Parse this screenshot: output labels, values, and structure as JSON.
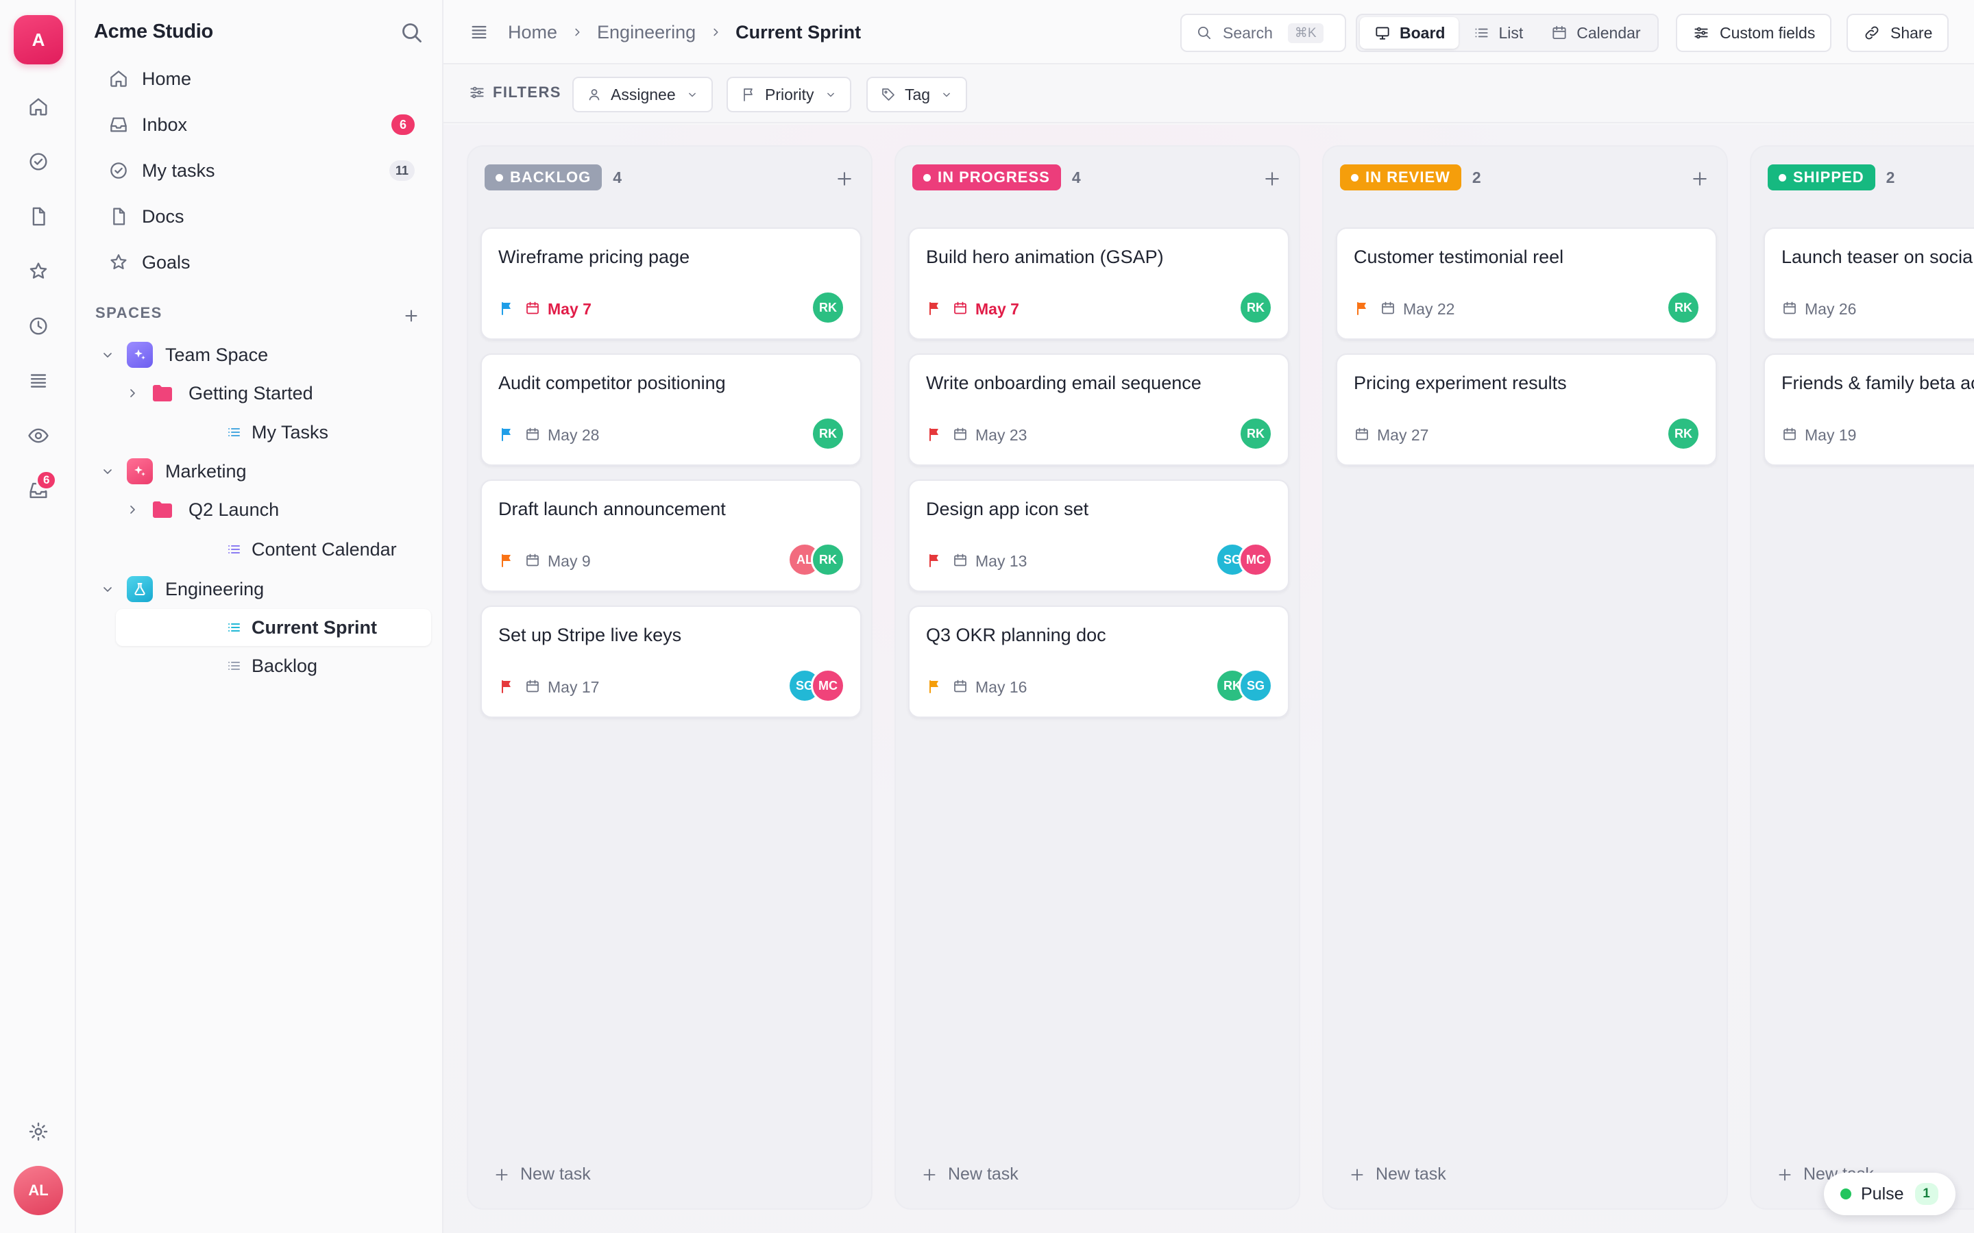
{
  "workspace": {
    "initial": "A",
    "name": "Acme Studio",
    "user_initials": "AL",
    "rail_inbox_badge": "6"
  },
  "nav": [
    {
      "label": "Home",
      "icon": "home-icon"
    },
    {
      "label": "Inbox",
      "icon": "inbox-icon",
      "count": "6"
    },
    {
      "label": "My tasks",
      "icon": "check-circle-icon",
      "count": "11"
    },
    {
      "label": "Docs",
      "icon": "doc-icon"
    },
    {
      "label": "Goals",
      "icon": "star-icon"
    }
  ],
  "spaces": {
    "heading": "SPACES",
    "items": [
      {
        "label": "Team Space",
        "color": "#7c6cf0",
        "children": [
          {
            "label": "Getting Started",
            "type": "folder"
          },
          {
            "label": "My Tasks",
            "type": "list"
          }
        ]
      },
      {
        "label": "Marketing",
        "color": "#f0437a",
        "children": [
          {
            "label": "Q2 Launch",
            "type": "folder"
          },
          {
            "label": "Content Calendar",
            "type": "list"
          }
        ]
      },
      {
        "label": "Engineering",
        "color": "#22b8d6",
        "children": [
          {
            "label": "Current Sprint",
            "type": "list",
            "active": true
          },
          {
            "label": "Backlog",
            "type": "list"
          }
        ]
      }
    ]
  },
  "breadcrumb": {
    "home": "Home",
    "space": "Engineering",
    "current": "Current Sprint"
  },
  "toolbar": {
    "search_label": "Search",
    "search_shortcut": "⌘K",
    "views": [
      {
        "label": "Board",
        "active": true
      },
      {
        "label": "List"
      },
      {
        "label": "Calendar"
      }
    ],
    "custom_fields": "Custom fields",
    "share": "Share"
  },
  "filters": {
    "label": "FILTERS",
    "chips": [
      "Assignee",
      "Priority",
      "Tag"
    ]
  },
  "people": {
    "RK": "#2bbf82",
    "MC": "#f0437a",
    "SG": "#22b8d6",
    "AL": "#f26b7e"
  },
  "priority_colors": {
    "urgent": "#e5383b",
    "high": "#f97316",
    "normal": "#1f9ee8",
    "low": "#f59e0b"
  },
  "columns": [
    {
      "status": "BACKLOG",
      "color": "#9aa1b2",
      "count": "4",
      "new_task": "New task",
      "cards": [
        {
          "title": "Wireframe pricing page",
          "priority": "normal",
          "date": "May 7",
          "due": true,
          "assignees": [
            "RK"
          ]
        },
        {
          "title": "Audit competitor positioning",
          "priority": "normal",
          "date": "May 28",
          "assignees": [
            "RK"
          ]
        },
        {
          "title": "Draft launch announcement",
          "priority": "high",
          "date": "May 9",
          "assignees": [
            "AL",
            "RK"
          ]
        },
        {
          "title": "Set up Stripe live keys",
          "priority": "urgent",
          "date": "May 17",
          "assignees": [
            "SG",
            "MC"
          ]
        }
      ]
    },
    {
      "status": "IN PROGRESS",
      "color": "#ec3d7b",
      "count": "4",
      "new_task": "New task",
      "cards": [
        {
          "title": "Build hero animation (GSAP)",
          "priority": "urgent",
          "date": "May 7",
          "due": true,
          "assignees": [
            "RK"
          ]
        },
        {
          "title": "Write onboarding email sequence",
          "priority": "urgent",
          "date": "May 23",
          "assignees": [
            "RK"
          ]
        },
        {
          "title": "Design app icon set",
          "priority": "urgent",
          "date": "May 13",
          "assignees": [
            "SG",
            "MC"
          ]
        },
        {
          "title": "Q3 OKR planning doc",
          "priority": "low",
          "date": "May 16",
          "assignees": [
            "RK",
            "SG"
          ]
        }
      ]
    },
    {
      "status": "IN REVIEW",
      "color": "#f59e0b",
      "count": "2",
      "new_task": "New task",
      "cards": [
        {
          "title": "Customer testimonial reel",
          "priority": "high",
          "date": "May 22",
          "assignees": [
            "RK"
          ]
        },
        {
          "title": "Pricing experiment results",
          "priority": "",
          "date": "May 27",
          "assignees": [
            "RK"
          ]
        }
      ]
    },
    {
      "status": "SHIPPED",
      "color": "#16b980",
      "count": "2",
      "new_task": "New task",
      "cards": [
        {
          "title": "Launch teaser on social",
          "priority": "",
          "date": "May 26",
          "assignees": []
        },
        {
          "title": "Friends & family beta access",
          "priority": "",
          "date": "May 19",
          "assignees": []
        }
      ]
    }
  ],
  "pulse": {
    "label": "Pulse",
    "count": "1"
  }
}
